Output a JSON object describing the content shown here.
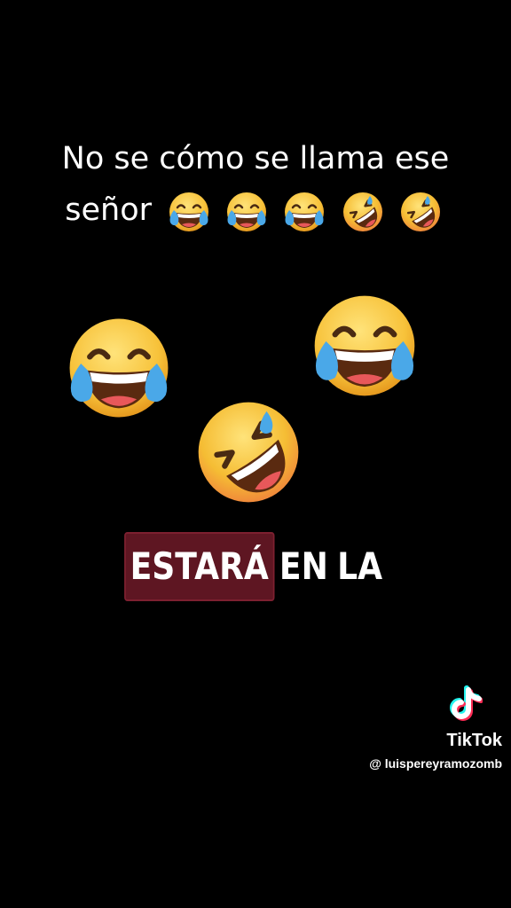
{
  "caption": {
    "line1": "No se cómo se llama ese",
    "line2": "señor",
    "emojis": [
      "tears-of-joy-emoji",
      "tears-of-joy-emoji",
      "tears-of-joy-emoji",
      "rolling-on-floor-laughing-emoji",
      "rolling-on-floor-laughing-emoji"
    ]
  },
  "floating_emojis": [
    "tears-of-joy-emoji",
    "tears-of-joy-emoji",
    "rolling-on-floor-laughing-emoji"
  ],
  "subtitle": {
    "highlighted_word": "ESTARÁ",
    "rest": [
      "EN",
      "LA"
    ],
    "highlight_color": "#5e1622"
  },
  "watermark": {
    "brand": "TikTok",
    "handle": "@ luispereyramozomb",
    "icon": "tiktok-note-icon",
    "colors": {
      "cyan": "#25f4ee",
      "red": "#fe2c55",
      "white": "#ffffff"
    }
  },
  "colors": {
    "background": "#000000",
    "emoji_face": "#f7c23a",
    "tear": "#4aa8e8",
    "mouth": "#5a2a10"
  }
}
